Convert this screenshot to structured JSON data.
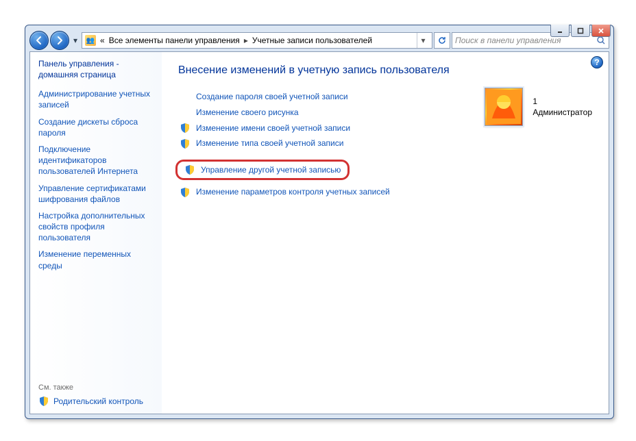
{
  "breadcrumb": {
    "prefix": "«",
    "root": "Все элементы панели управления",
    "current": "Учетные записи пользователей"
  },
  "search": {
    "placeholder": "Поиск в панели управления"
  },
  "sidebar": {
    "heading": "Панель управления - домашняя страница",
    "links": [
      "Администрирование учетных записей",
      "Создание дискеты сброса пароля",
      "Подключение идентификаторов пользователей Интернета",
      "Управление сертификатами шифрования файлов",
      "Настройка дополнительных свойств профиля пользователя",
      "Изменение переменных среды"
    ],
    "see_also_label": "См. также",
    "parental_control": "Родительский контроль"
  },
  "main": {
    "title": "Внесение изменений в учетную запись пользователя",
    "tasks_group1": [
      {
        "label": "Создание пароля своей учетной записи",
        "shield": false
      },
      {
        "label": "Изменение своего рисунка",
        "shield": false
      },
      {
        "label": "Изменение имени своей учетной записи",
        "shield": true
      },
      {
        "label": "Изменение типа своей учетной записи",
        "shield": true
      }
    ],
    "highlighted_task": {
      "label": "Управление другой учетной записью",
      "shield": true
    },
    "tasks_group2": [
      {
        "label": "Изменение параметров контроля учетных записей",
        "shield": true
      }
    ]
  },
  "account": {
    "name": "1",
    "role": "Администратор"
  },
  "help_glyph": "?"
}
